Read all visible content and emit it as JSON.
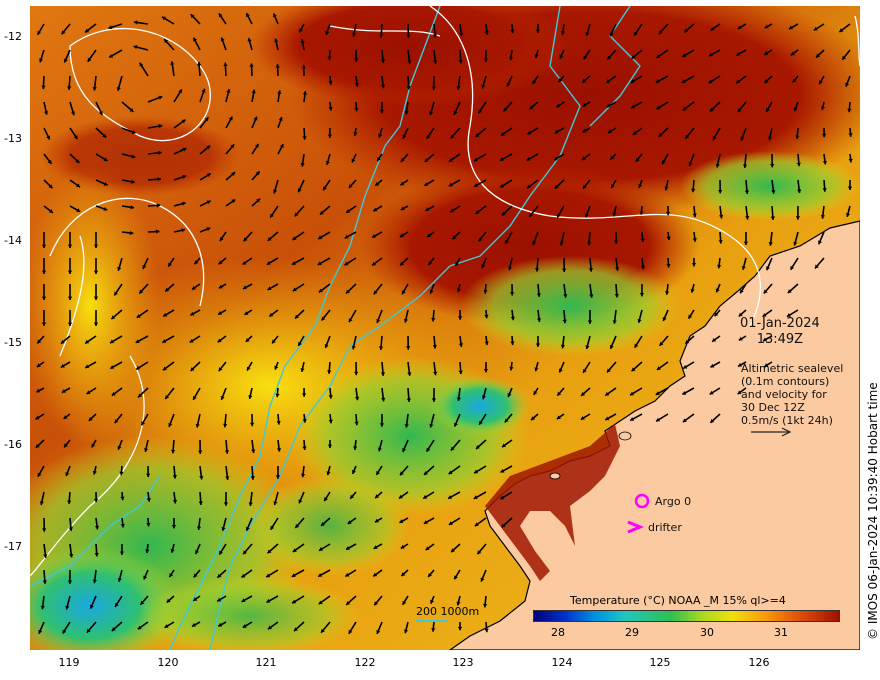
{
  "map": {
    "date": "01-Jan-2024",
    "time": "13:49Z",
    "altimetry_note_lines": [
      "Altimetric sealevel",
      "(0.1m contours)",
      "and velocity for",
      "30 Dec 12Z",
      "0.5m/s (1kt 24h)"
    ],
    "copyright": "© IMOS 06-Jan-2024 10:39:40 Hobart time",
    "latitude_ticks": [
      "-12",
      "-13",
      "-14",
      "-15",
      "-16",
      "-17"
    ],
    "longitude_ticks": [
      "119",
      "120",
      "121",
      "122",
      "123",
      "124",
      "125",
      "126"
    ],
    "legend": {
      "argo_label": "Argo 0",
      "drifter_label": "drifter",
      "depth_contours_label": "200  1000m"
    },
    "colorbar": {
      "title": "Temperature (°C) NOAA _M 15% ql>=4",
      "ticks": [
        "28",
        "29",
        "30",
        "31"
      ]
    },
    "colors": {
      "land": "#fbcaa0",
      "bathymetry_contour": "#40c8d8",
      "sealevel_contour": "#ffffff",
      "marker": "#ff00ff"
    },
    "icons": [
      "argo-float-icon",
      "drifter-icon",
      "velocity-scale-arrow-icon"
    ]
  }
}
